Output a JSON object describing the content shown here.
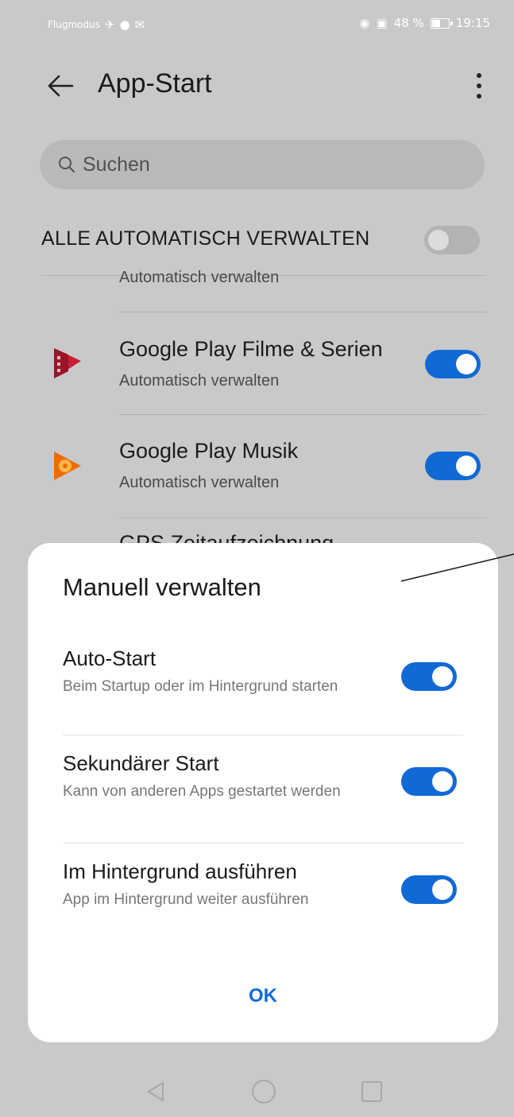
{
  "status_bar": {
    "mode_text": "Flugmodus",
    "battery_text": "48 %",
    "battery_level": 0.48,
    "time": "19:15"
  },
  "app_bar": {
    "title": "App-Start",
    "back_icon": "arrow-left-icon",
    "more_icon": "more-vert-icon"
  },
  "search": {
    "placeholder": "Suchen",
    "value": ""
  },
  "manage_all": {
    "label": "ALLE AUTOMATISCH VERWALTEN",
    "enabled": false
  },
  "apps": {
    "clipped_sub": "Automatisch verwalten",
    "items": [
      {
        "name": "Google Play Filme & Serien",
        "sub": "Automatisch verwalten",
        "icon": "play-movies-icon",
        "enabled": true
      },
      {
        "name": "Google Play Musik",
        "sub": "Automatisch verwalten",
        "icon": "play-music-icon",
        "enabled": true
      }
    ],
    "peek_name": "GPS Zeitaufzeichnung"
  },
  "dialog": {
    "title": "Manuell verwalten",
    "options": [
      {
        "title": "Auto-Start",
        "desc": "Beim Startup oder im Hintergrund starten",
        "enabled": true
      },
      {
        "title": "Sekundärer Start",
        "desc": "Kann von anderen Apps gestartet werden",
        "enabled": true
      },
      {
        "title": "Im Hintergrund ausführen",
        "desc": "App im Hintergrund weiter ausführen",
        "enabled": true
      }
    ],
    "ok_label": "OK"
  },
  "nav_bar": {
    "icons": [
      "nav-back-icon",
      "nav-home-icon",
      "nav-recents-icon"
    ]
  },
  "colors": {
    "accent": "#1169d6",
    "scrim": "#c9c9c9",
    "dialog_bg": "#ffffff"
  }
}
